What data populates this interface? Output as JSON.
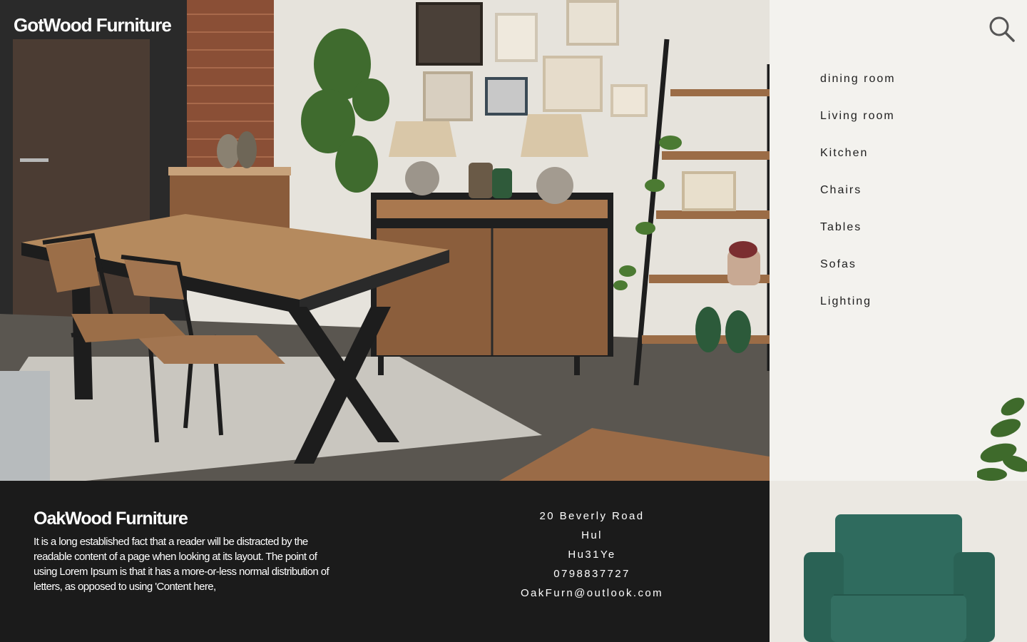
{
  "brand": "GotWood Furniture",
  "search": {
    "icon": "search-icon"
  },
  "nav": {
    "items": [
      {
        "label": "dining room"
      },
      {
        "label": "Living room"
      },
      {
        "label": "Kitchen"
      },
      {
        "label": "Chairs"
      },
      {
        "label": "Tables"
      },
      {
        "label": "Sofas"
      },
      {
        "label": "Lighting"
      }
    ]
  },
  "footer": {
    "title": "OakWood Furniture",
    "description": "It is a long established fact that a reader will be distracted by the readable content of a page when looking at its layout. The point of using Lorem Ipsum is that it has a more-or-less normal distribution of letters, as opposed to using 'Content here,",
    "address_line1": "20 Beverly Road",
    "address_line2": "Hul",
    "postcode": "Hu31Ye",
    "phone": "0798837727",
    "email": "OakFurn@outlook.com"
  },
  "colors": {
    "footer_bg": "#1b1b1b",
    "panel_bg": "#f3f2ee",
    "armchair": "#2f6b5e"
  }
}
